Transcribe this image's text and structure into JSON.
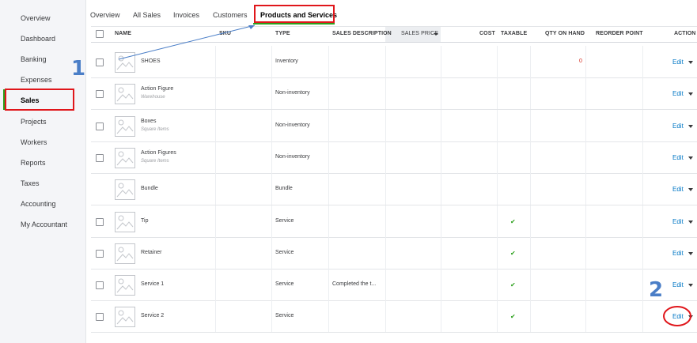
{
  "sidebar": {
    "items": [
      {
        "label": "Overview"
      },
      {
        "label": "Dashboard"
      },
      {
        "label": "Banking"
      },
      {
        "label": "Expenses"
      },
      {
        "label": "Sales"
      },
      {
        "label": "Projects"
      },
      {
        "label": "Workers"
      },
      {
        "label": "Reports"
      },
      {
        "label": "Taxes"
      },
      {
        "label": "Accounting"
      },
      {
        "label": "My Accountant"
      }
    ]
  },
  "tabs": [
    {
      "label": "Overview"
    },
    {
      "label": "All Sales"
    },
    {
      "label": "Invoices"
    },
    {
      "label": "Customers"
    },
    {
      "label": "Products and Services"
    }
  ],
  "table": {
    "headers": {
      "name": "NAME",
      "sku": "SKU",
      "type": "TYPE",
      "sales_description": "SALES DESCRIPTION",
      "sales_price": "SALES PRICE",
      "cost": "COST",
      "taxable": "TAXABLE",
      "qty_on_hand": "QTY ON HAND",
      "reorder_point": "REORDER POINT",
      "action": "ACTION"
    },
    "rows": [
      {
        "name": "SHOES",
        "sub": "",
        "type": "Inventory",
        "desc": "",
        "taxable": false,
        "qty": "0",
        "edit": "Edit"
      },
      {
        "name": "Action Figure",
        "sub": "Warehouse",
        "type": "Non-inventory",
        "desc": "",
        "taxable": false,
        "qty": "",
        "edit": "Edit"
      },
      {
        "name": "Boxes",
        "sub": "Square Items",
        "type": "Non-inventory",
        "desc": "",
        "taxable": false,
        "qty": "",
        "edit": "Edit"
      },
      {
        "name": "Action Figures",
        "sub": "Square Items",
        "type": "Non-inventory",
        "desc": "",
        "taxable": false,
        "qty": "",
        "edit": "Edit"
      },
      {
        "name": "Bundle",
        "sub": "",
        "type": "Bundle",
        "desc": "",
        "taxable": false,
        "qty": "",
        "edit": "Edit"
      },
      {
        "name": "Tip",
        "sub": "",
        "type": "Service",
        "desc": "",
        "taxable": true,
        "qty": "",
        "edit": "Edit"
      },
      {
        "name": "Retainer",
        "sub": "",
        "type": "Service",
        "desc": "",
        "taxable": true,
        "qty": "",
        "edit": "Edit"
      },
      {
        "name": "Service 1",
        "sub": "",
        "type": "Service",
        "desc": "Completed the t...",
        "taxable": true,
        "qty": "",
        "edit": "Edit"
      },
      {
        "name": "Service 2",
        "sub": "",
        "type": "Service",
        "desc": "",
        "taxable": true,
        "qty": "",
        "edit": "Edit"
      }
    ],
    "checkmark": "✔"
  },
  "annotations": {
    "step1": "1",
    "step2": "2"
  },
  "colors": {
    "accent": "#2ca01c",
    "link": "#0077c5",
    "annotation_red": "#e0161b",
    "annotation_blue": "#4a7ec7"
  }
}
